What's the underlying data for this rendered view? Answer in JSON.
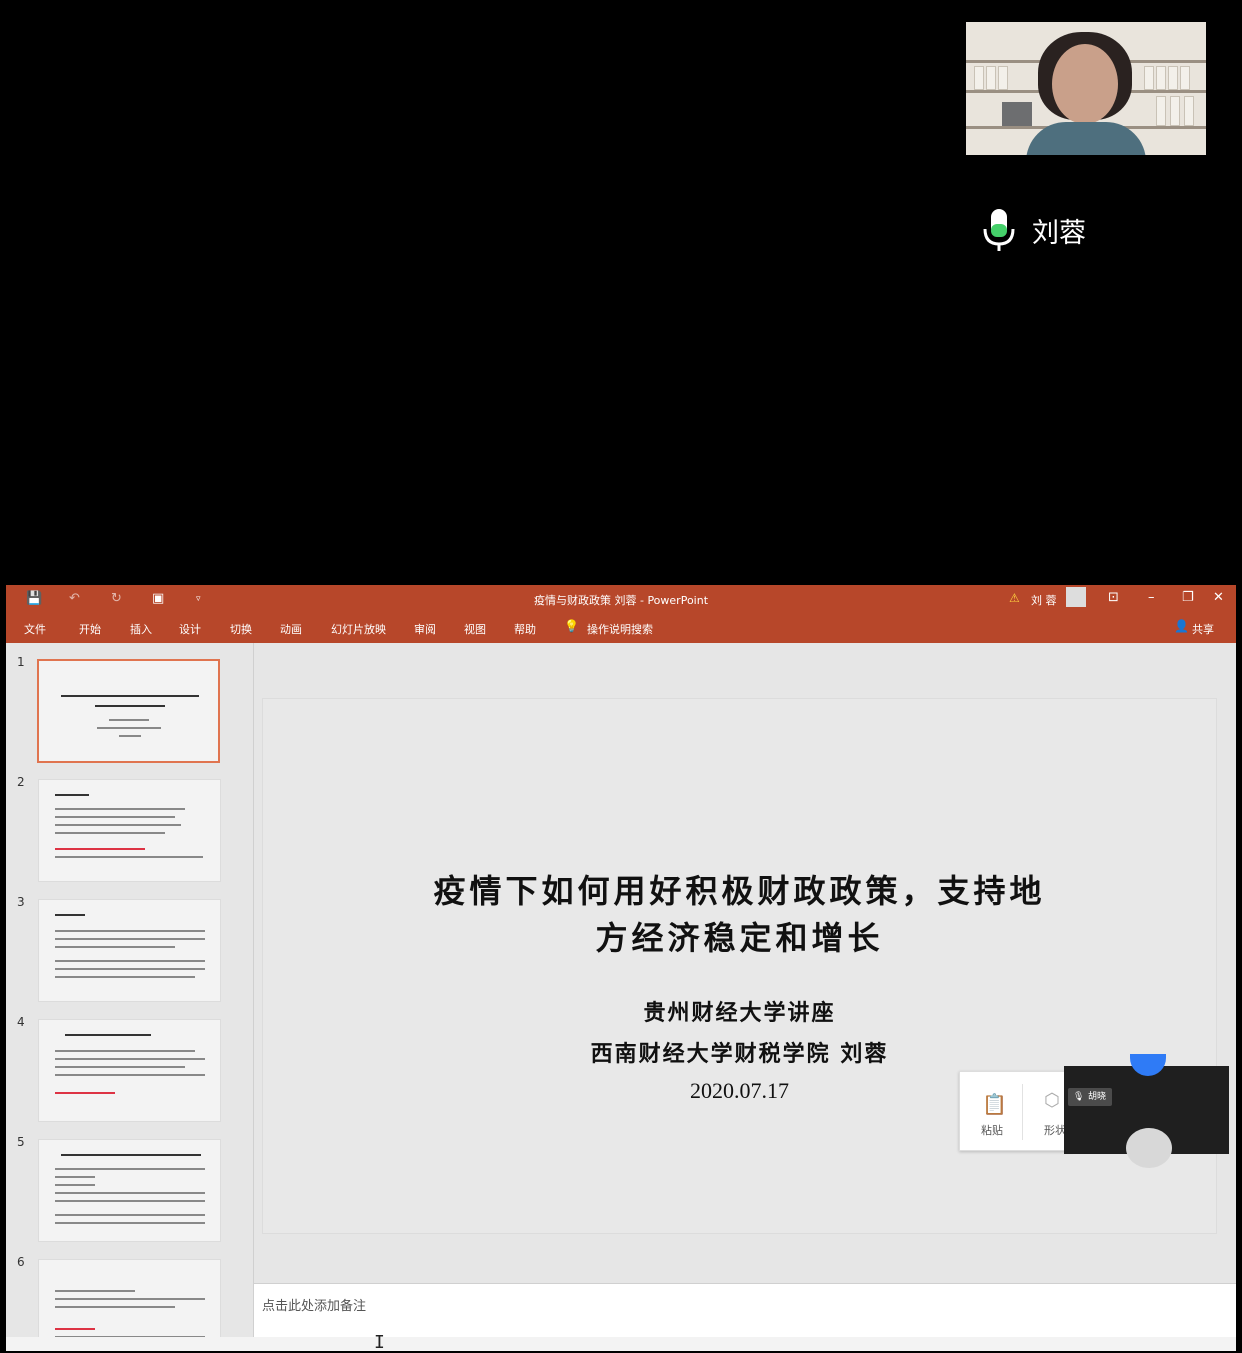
{
  "participant": {
    "name": "刘蓉"
  },
  "ppt": {
    "window_title": "疫情与财政政策 刘蓉 - PowerPoint",
    "user_name": "刘 蓉",
    "warning_icon": "warning-icon",
    "ribbon_tabs": [
      "文件",
      "开始",
      "插入",
      "设计",
      "切换",
      "动画",
      "幻灯片放映",
      "审阅",
      "视图",
      "帮助"
    ],
    "tell_me": "操作说明搜索",
    "share": "共享",
    "thumbnails": [
      "1",
      "2",
      "3",
      "4",
      "5",
      "6"
    ],
    "slide": {
      "title_line1": "疫情下如何用好积极财政政策，支持地",
      "title_line2": "方经济稳定和增长",
      "subtitle1": "贵州财经大学讲座",
      "subtitle2": "西南财经大学财税学院 刘蓉",
      "date": "2020.07.17"
    },
    "notes_placeholder": "点击此处添加备注",
    "paste_popup": {
      "paste": "粘贴",
      "shape": "形状"
    },
    "minicam_name": "胡晓"
  },
  "colors": {
    "ribbon": "#b7472a",
    "selection": "#e0744f",
    "mic_active": "#45d06a"
  }
}
